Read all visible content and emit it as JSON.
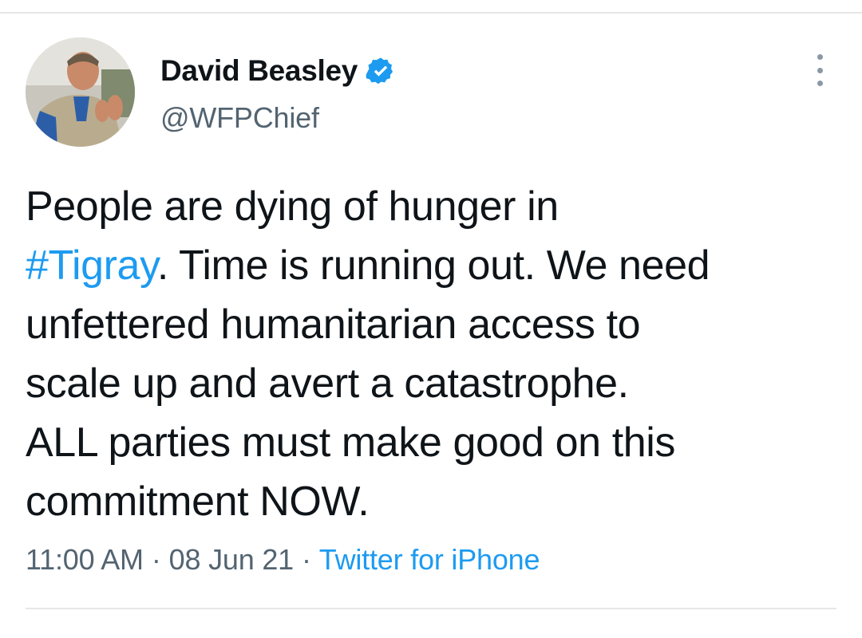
{
  "author": {
    "display_name": "David Beasley",
    "handle": "@WFPChief",
    "verified": true
  },
  "tweet": {
    "lines": [
      [
        "People are dying of hunger in"
      ],
      [
        "#Tigray",
        ". Time is running out. We need"
      ],
      [
        "unfettered humanitarian access to"
      ],
      [
        "scale up and avert a catastrophe."
      ],
      [
        "ALL parties must make good on this"
      ],
      [
        "commitment NOW."
      ]
    ],
    "hashtag": "#Tigray"
  },
  "meta": {
    "time": "11:00 AM",
    "separator": "·",
    "date": "08 Jun 21",
    "source": "Twitter for iPhone"
  },
  "icons": {
    "verified": "verified-badge-icon",
    "more": "more-vertical-icon"
  },
  "colors": {
    "link": "#1d9bf0",
    "secondary_text": "#536471",
    "primary_text": "#0f1419"
  }
}
